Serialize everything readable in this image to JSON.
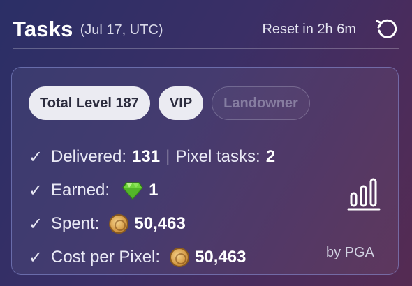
{
  "header": {
    "title": "Tasks",
    "subtitle": "(Jul 17, UTC)",
    "reset_text": "Reset in 2h 6m",
    "reset_icon": "refresh-icon"
  },
  "badges": [
    {
      "label": "Total Level 187",
      "active": true
    },
    {
      "label": "VIP",
      "active": true
    },
    {
      "label": "Landowner",
      "active": false
    }
  ],
  "rows": {
    "delivered_label": "Delivered:",
    "delivered_value": "131",
    "separator": "|",
    "pixel_tasks_label": "Pixel tasks:",
    "pixel_tasks_value": "2",
    "earned_label": "Earned:",
    "earned_icon": "gem-icon",
    "earned_value": "1",
    "spent_label": "Spent:",
    "spent_icon": "coin-icon",
    "spent_value": "50,463",
    "cost_label": "Cost per Pixel:",
    "cost_icon": "coin-icon",
    "cost_value": "50,463"
  },
  "stats_icon": "bar-chart-icon",
  "footer": {
    "by": "by PGA"
  },
  "colors": {
    "badge_active_bg": "#ebebf2",
    "card_border": "#8c96dc"
  }
}
